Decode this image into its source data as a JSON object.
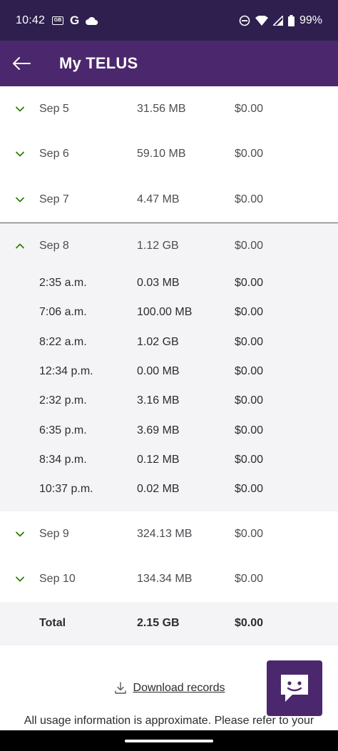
{
  "status_bar": {
    "time": "10:42",
    "battery": "99%",
    "icons": [
      "gmail-badge-icon",
      "google-icon",
      "cloud-icon",
      "do-not-disturb-icon",
      "wifi-icon",
      "signal-icon",
      "battery-icon"
    ]
  },
  "app_bar": {
    "title": "My TELUS",
    "back_icon": "back-arrow-icon"
  },
  "rows_before": [
    {
      "date": "Sep 5",
      "usage": "31.56 MB",
      "cost": "$0.00"
    },
    {
      "date": "Sep 6",
      "usage": "59.10 MB",
      "cost": "$0.00"
    },
    {
      "date": "Sep 7",
      "usage": "4.47 MB",
      "cost": "$0.00"
    }
  ],
  "expanded": {
    "date": "Sep 8",
    "usage": "1.12 GB",
    "cost": "$0.00",
    "entries": [
      {
        "time": "2:35 a.m.",
        "usage": "0.03 MB",
        "cost": "$0.00"
      },
      {
        "time": "7:06 a.m.",
        "usage": "100.00 MB",
        "cost": "$0.00"
      },
      {
        "time": "8:22 a.m.",
        "usage": "1.02 GB",
        "cost": "$0.00"
      },
      {
        "time": "12:34 p.m.",
        "usage": "0.00 MB",
        "cost": "$0.00"
      },
      {
        "time": "2:32 p.m.",
        "usage": "3.16 MB",
        "cost": "$0.00"
      },
      {
        "time": "6:35 p.m.",
        "usage": "3.69 MB",
        "cost": "$0.00"
      },
      {
        "time": "8:34 p.m.",
        "usage": "0.12 MB",
        "cost": "$0.00"
      },
      {
        "time": "10:37 p.m.",
        "usage": "0.02 MB",
        "cost": "$0.00"
      }
    ]
  },
  "rows_after": [
    {
      "date": "Sep 9",
      "usage": "324.13 MB",
      "cost": "$0.00"
    },
    {
      "date": "Sep 10",
      "usage": "134.34 MB",
      "cost": "$0.00"
    }
  ],
  "total": {
    "label": "Total",
    "usage": "2.15 GB",
    "cost": "$0.00"
  },
  "download_label": "Download records",
  "disclaimer": "All usage information is approximate. Please refer to your",
  "colors": {
    "brand_purple": "#4b286d",
    "status_purple": "#2e1f4f",
    "chevron_green": "#2b8000",
    "expanded_bg": "#f4f4f7"
  }
}
